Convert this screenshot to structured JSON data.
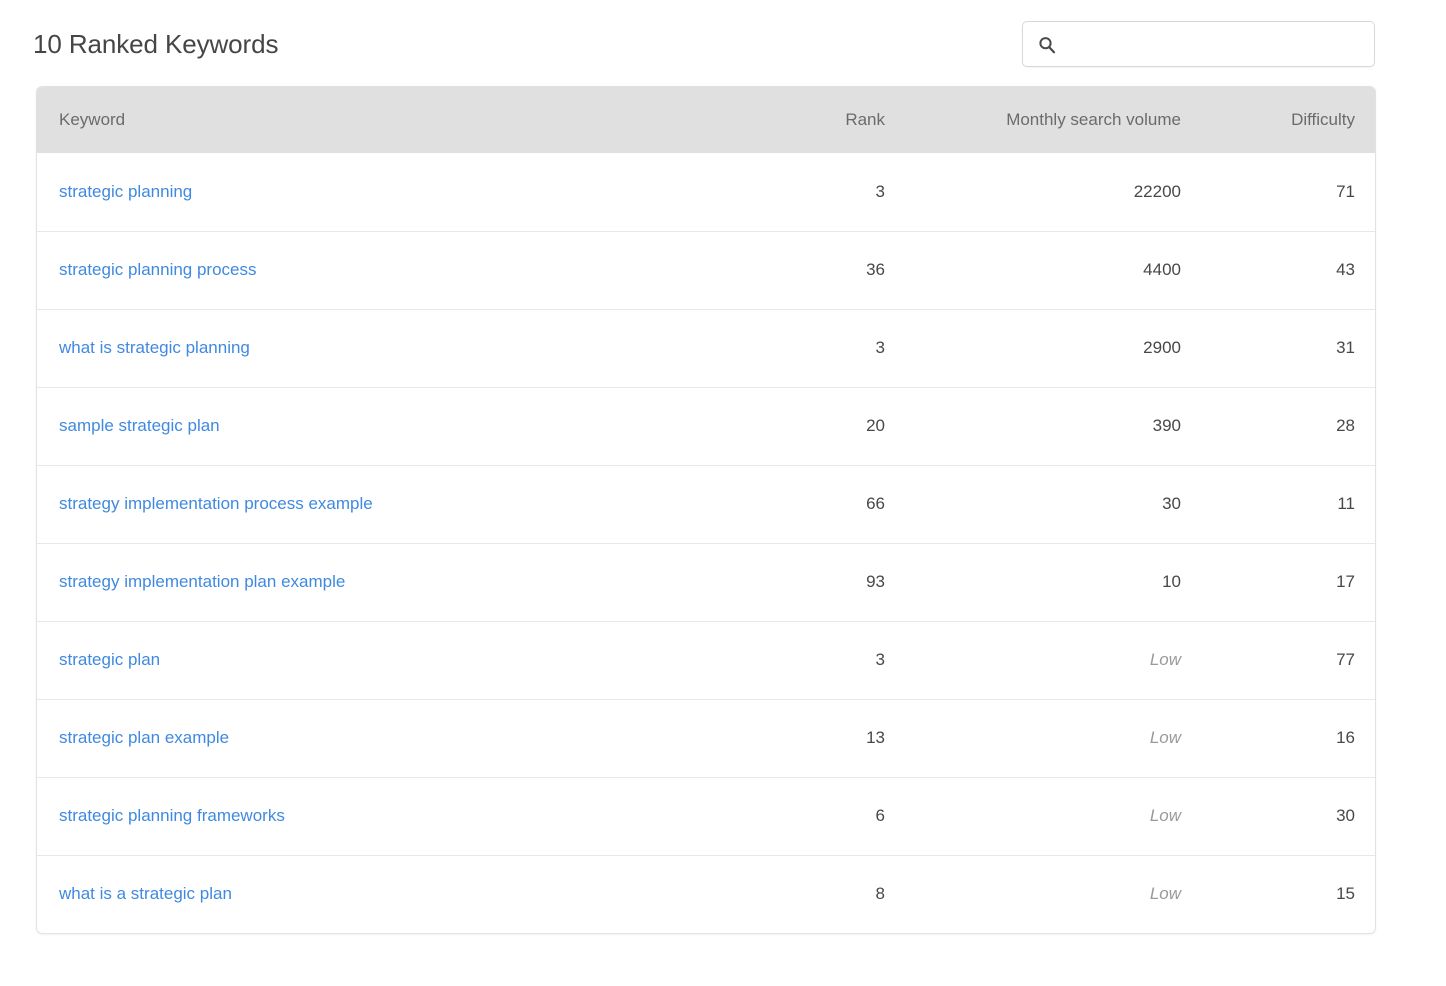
{
  "header": {
    "title": "10 Ranked Keywords"
  },
  "search": {
    "placeholder": "",
    "value": "",
    "icon": "search-icon"
  },
  "table": {
    "columns": [
      {
        "key": "keyword",
        "label": "Keyword",
        "align": "left"
      },
      {
        "key": "rank",
        "label": "Rank",
        "align": "right"
      },
      {
        "key": "volume",
        "label": "Monthly search volume",
        "align": "right"
      },
      {
        "key": "difficulty",
        "label": "Difficulty",
        "align": "right"
      }
    ],
    "rows": [
      {
        "keyword": "strategic planning",
        "rank": "3",
        "volume": "22200",
        "volume_low": false,
        "difficulty": "71"
      },
      {
        "keyword": "strategic planning process",
        "rank": "36",
        "volume": "4400",
        "volume_low": false,
        "difficulty": "43"
      },
      {
        "keyword": "what is strategic planning",
        "rank": "3",
        "volume": "2900",
        "volume_low": false,
        "difficulty": "31"
      },
      {
        "keyword": "sample strategic plan",
        "rank": "20",
        "volume": "390",
        "volume_low": false,
        "difficulty": "28"
      },
      {
        "keyword": "strategy implementation process example",
        "rank": "66",
        "volume": "30",
        "volume_low": false,
        "difficulty": "11"
      },
      {
        "keyword": "strategy implementation plan example",
        "rank": "93",
        "volume": "10",
        "volume_low": false,
        "difficulty": "17"
      },
      {
        "keyword": "strategic plan",
        "rank": "3",
        "volume": "Low",
        "volume_low": true,
        "difficulty": "77"
      },
      {
        "keyword": "strategic plan example",
        "rank": "13",
        "volume": "Low",
        "volume_low": true,
        "difficulty": "16"
      },
      {
        "keyword": "strategic planning frameworks",
        "rank": "6",
        "volume": "Low",
        "volume_low": true,
        "difficulty": "30"
      },
      {
        "keyword": "what is a strategic plan",
        "rank": "8",
        "volume": "Low",
        "volume_low": true,
        "difficulty": "15"
      }
    ]
  },
  "colors": {
    "link": "#4089e0",
    "header_bg": "#e0e0e0",
    "header_text": "#6b6b6b",
    "body_text": "#484848",
    "muted_text": "#9a9a9a",
    "title_text": "#464646",
    "border": "#e8e8e8"
  }
}
